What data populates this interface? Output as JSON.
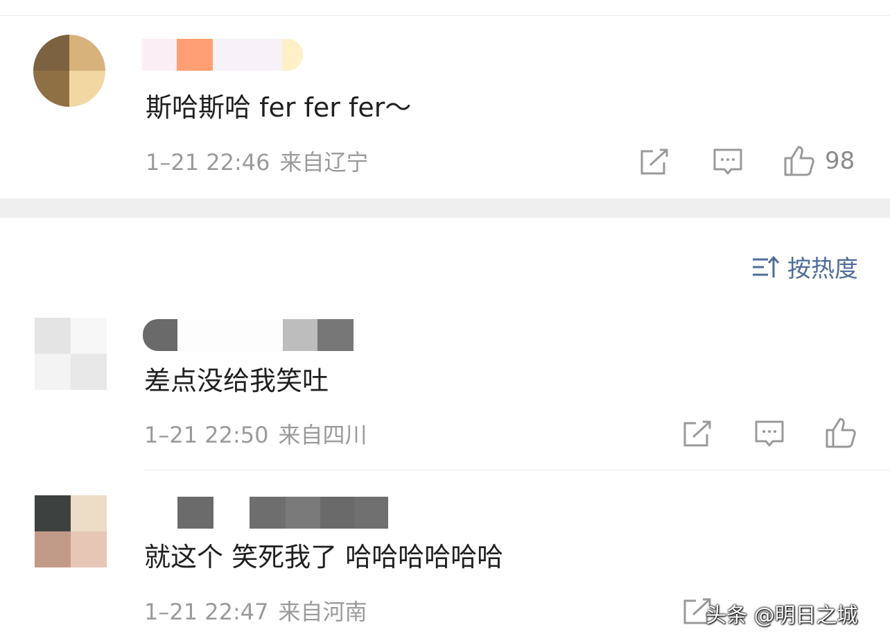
{
  "comments": [
    {
      "text": "斯哈斯哈 fer fer fer～",
      "time": "1–21 22:46",
      "location": "来自辽宁",
      "likes": "98"
    },
    {
      "text": "差点没给我笑吐",
      "time": "1–21 22:50",
      "location": "来自四川",
      "likes": ""
    },
    {
      "text": "就这个 笑死我了 哈哈哈哈哈哈",
      "time": "1–21 22:47",
      "location": "来自河南",
      "likes": ""
    }
  ],
  "sort": {
    "label": "按热度"
  },
  "watermark": "头条 @明日之城",
  "colors": {
    "accent": "#4f6d99",
    "meta_text": "#9a9a9a",
    "divider": "#efefef"
  },
  "icons": [
    "share-icon",
    "comment-icon",
    "like-icon",
    "sort-icon"
  ]
}
